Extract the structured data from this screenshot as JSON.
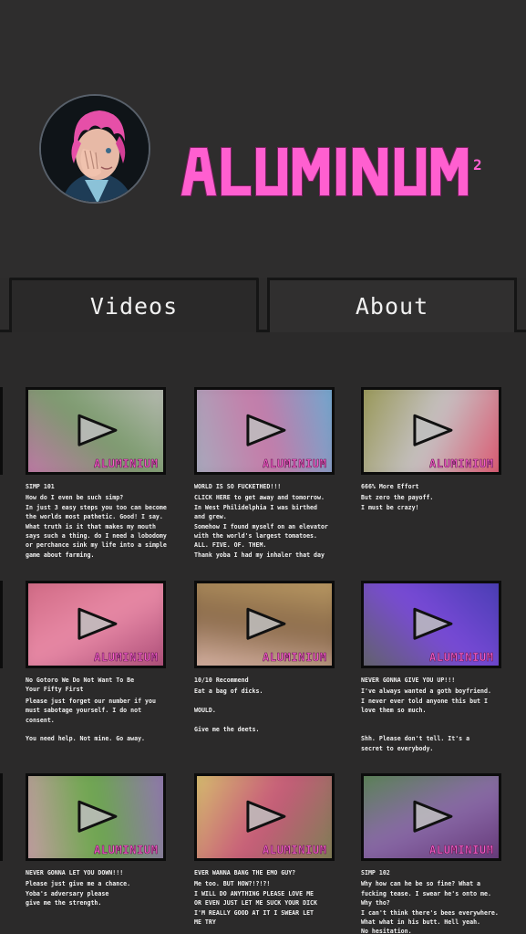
{
  "brand": {
    "name": "ALUMINIUM",
    "superscript": "2",
    "accent": "#ff5fd0"
  },
  "tabs": [
    {
      "label": "Videos",
      "active": true
    },
    {
      "label": "About",
      "active": false
    }
  ],
  "videos": [
    {
      "title": "SIMP 101",
      "body": "How do I even be such simp?\nIn just 3 easy steps you too can become\nthe worlds most pathetic. Good! I say.\nWhat truth is it that makes my mouth\nsays such a thing. do I need a lobodomy\nor perchance sink my life into a simple\ngame about farming.",
      "watermark": "ALUMINIUM",
      "colors": [
        "#d46fb8",
        "#7a9a6c",
        "#c9c4c6"
      ]
    },
    {
      "title": "WORLD IS SO FUCKETHED!!!",
      "body": "CLICK HERE to get away and tomorrow.\nIn West Philidelphia I was birthed\nand grew.\nSomehow I found myself on an elevator\nwith the world's largest tomatoes.\nALL. FIVE. OF. THEM.\nThank yoba I had my inhaler that day",
      "watermark": "ALUMINIUM",
      "colors": [
        "#9fb6c2",
        "#c77aa8",
        "#5ab3d8"
      ]
    },
    {
      "title": "666% More Effort",
      "body": "But zero the payoff.\nI must be crazy!",
      "watermark": "ALUMINIUM",
      "colors": [
        "#8c8c3a",
        "#c6c2c4",
        "#e03c5a"
      ]
    },
    {
      "title": "No Gotoro We Do Not Want To Be\nYour Fifty First",
      "body": "Please just forget our number if you\nmust sabotage yourself. I do not\nconsent.\n\nYou need help. Not mine. Go away.",
      "watermark": "ALUMINIUM",
      "colors": [
        "#c9607a",
        "#e88aa6",
        "#9a3a6a"
      ]
    },
    {
      "title": "10/10 Recommend",
      "body": "Eat a bag of dicks.\n\nWOULD.\n\nGive me the deets.",
      "watermark": "ALUMINIUM",
      "colors": [
        "#c9a86a",
        "#8a6a4a",
        "#efc9c0"
      ]
    },
    {
      "title": "NEVER GONNA GIVE YOU UP!!!",
      "body": "I've always wanted a goth boyfriend.\nI never ever told anyone this but I\nlove them so much.\n\n\nShh. Please don't tell. It's a\nsecret to everybody.",
      "watermark": "ALUMINIUM",
      "colors": [
        "#3a3aa8",
        "#7a4ad8",
        "#5a6a4a"
      ]
    },
    {
      "title": "NEVER GONNA LET YOU DOWN!!!",
      "body": "Please just give me a chance.\nYoba's adversary please\ngive me the strength.",
      "watermark": "ALUMINIUM",
      "colors": [
        "#9a6ac8",
        "#6aa84a",
        "#d89ab8"
      ]
    },
    {
      "title": "EVER WANNA BANG THE EMO GUY?",
      "body": "Me too. BUT HOW?!?!?!\nI WILL DO ANYTHING PLEASE LOVE ME\nOR EVEN JUST LET ME SUCK YOUR DICK\nI'M REALLY GOOD AT IT I SWEAR LET\nME TRY",
      "watermark": "ALUMINIUM",
      "colors": [
        "#6a8a4a",
        "#c85a7a",
        "#d8d86a"
      ]
    },
    {
      "title": "SIMP 102",
      "body": "Why how can he be so fine? What a\nfucking tease. I swear he's onto me.\nWhy tho?\nI can't think there's bees everywhere.\nWhat what in his butt. Hell yeah.\nNo hesitation.",
      "watermark": "ALUMINIUM",
      "colors": [
        "#5a2a6a",
        "#8a6aa8",
        "#4a8a3a"
      ]
    }
  ]
}
